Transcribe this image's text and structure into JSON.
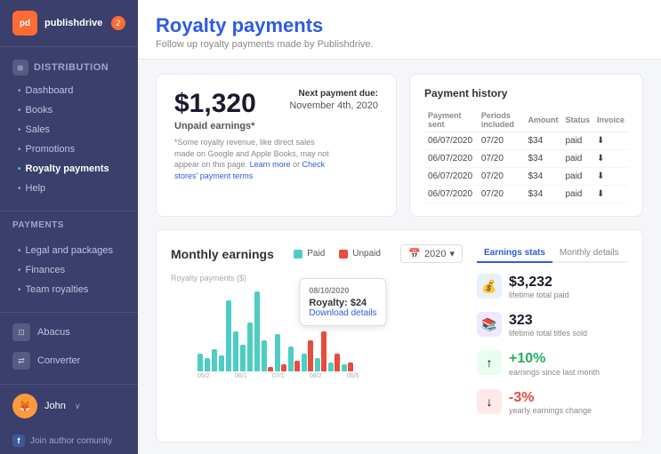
{
  "app": {
    "logo_text": "publishdrive",
    "notification_count": "2"
  },
  "sidebar": {
    "section_distribution": "Distribution",
    "items_distribution": [
      {
        "label": "Dashboard",
        "active": false
      },
      {
        "label": "Books",
        "active": false
      },
      {
        "label": "Sales",
        "active": false
      },
      {
        "label": "Promotions",
        "active": false
      },
      {
        "label": "Royalty payments",
        "active": true
      },
      {
        "label": "Help",
        "active": false
      }
    ],
    "section_payments": "PAYMENTS",
    "items_payments": [
      {
        "label": "Legal and packages"
      },
      {
        "label": "Finances"
      },
      {
        "label": "Team royalties"
      }
    ],
    "other_nav": [
      {
        "label": "Abacus"
      },
      {
        "label": "Converter"
      }
    ],
    "user": {
      "name": "John"
    },
    "join_label": "Join author comunity"
  },
  "page": {
    "title": "Royalty payments",
    "subtitle": "Follow up royalty payments made by Publishdrive."
  },
  "earnings_card": {
    "amount": "$1,320",
    "label": "Unpaid earnings*",
    "note": "*Some royalty revenue, like direct sales made on Google and Apple Books, may not appear on this page.",
    "note_link1": "Learn more",
    "note_link2": "Check stores' payment terms",
    "next_payment_label": "Next payment due:",
    "next_payment_date": "November 4th, 2020"
  },
  "payment_history": {
    "title": "Payment history",
    "headers": [
      "Payment sent",
      "Periods included",
      "Amount",
      "Status",
      "Invoice"
    ],
    "rows": [
      {
        "date": "06/07/2020",
        "period": "07/20",
        "amount": "$34",
        "status": "paid"
      },
      {
        "date": "06/07/2020",
        "period": "07/20",
        "amount": "$34",
        "status": "paid"
      },
      {
        "date": "06/07/2020",
        "period": "07/20",
        "amount": "$34",
        "status": "paid"
      },
      {
        "date": "06/07/2020",
        "period": "07/20",
        "amount": "$34",
        "status": "paid"
      }
    ]
  },
  "monthly_earnings": {
    "title": "Monthly earnings",
    "legend_paid": "Paid",
    "legend_unpaid": "Unpaid",
    "year": "2020",
    "axis_label": "Royalty payments ($)",
    "tooltip": {
      "date": "08/10/2020",
      "royalty": "Royalty: $24",
      "link": "Download details"
    },
    "bars": [
      {
        "paid": 20,
        "unpaid": 0
      },
      {
        "paid": 15,
        "unpaid": 0
      },
      {
        "paid": 25,
        "unpaid": 0
      },
      {
        "paid": 18,
        "unpaid": 0
      },
      {
        "paid": 80,
        "unpaid": 0
      },
      {
        "paid": 45,
        "unpaid": 0
      },
      {
        "paid": 30,
        "unpaid": 0
      },
      {
        "paid": 55,
        "unpaid": 0
      },
      {
        "paid": 90,
        "unpaid": 0
      },
      {
        "paid": 35,
        "unpaid": 5
      },
      {
        "paid": 42,
        "unpaid": 8
      },
      {
        "paid": 28,
        "unpaid": 12
      },
      {
        "paid": 20,
        "unpaid": 35
      },
      {
        "paid": 15,
        "unpaid": 45
      },
      {
        "paid": 10,
        "unpaid": 20
      },
      {
        "paid": 8,
        "unpaid": 10
      }
    ],
    "x_labels": [
      "05/2",
      "06/1",
      "07/1",
      "08/2",
      "05/5"
    ]
  },
  "earnings_stats": {
    "tab_stats": "Earnings stats",
    "tab_monthly": "Monthly details",
    "lifetime_paid_value": "$3,232",
    "lifetime_paid_label": "lifetime total paid",
    "titles_sold_value": "323",
    "titles_sold_label": "lifetime total titles sold",
    "since_last_month_value": "+10%",
    "since_last_month_label": "earnings since last month",
    "yearly_change_value": "-3%",
    "yearly_change_label": "yearly earnings change"
  }
}
